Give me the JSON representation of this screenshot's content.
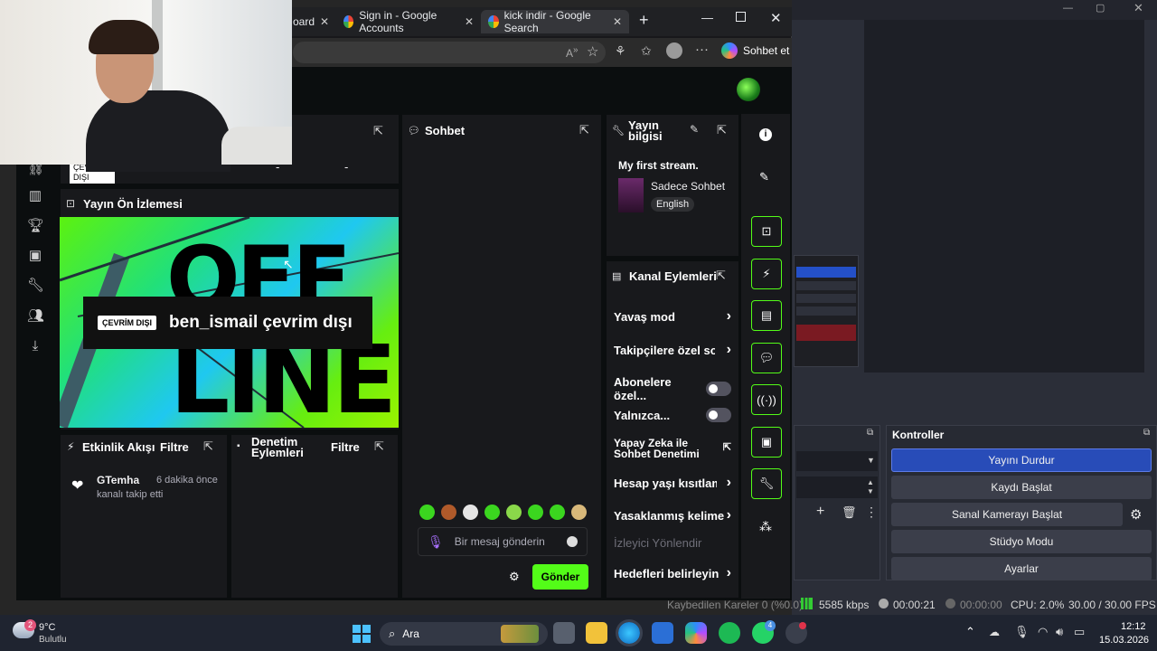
{
  "browser": {
    "tabs": [
      {
        "label": "oard",
        "icon": "kick-icon"
      },
      {
        "label": "Sign in - Google Accounts",
        "icon": "google-icon"
      },
      {
        "label": "kick indir - Google Search",
        "icon": "google-icon"
      }
    ],
    "copilot_label": "Sohbet et"
  },
  "stats": {
    "status_badge": "ÇEVRİM\nDIŞI",
    "values": [
      "-",
      "-",
      "-",
      "-"
    ]
  },
  "preview": {
    "title": "Yayın Ön İzlemesi",
    "offline_badge": "ÇEVRİM DIŞI",
    "offline_text": "ben_ismail çevrim dışı",
    "big_text_top": "OFF",
    "big_text_bottom": "LINE"
  },
  "activity": {
    "title": "Etkinlik Akışı",
    "filter": "Filtre",
    "items": [
      {
        "user": "GTemha",
        "time": "6 dakika önce",
        "desc": "kanalı takip etti"
      }
    ]
  },
  "moderation": {
    "title": "Denetim Eylemleri",
    "filter": "Filtre"
  },
  "chat": {
    "title": "Sohbet",
    "input_placeholder": "Bir mesaj gönderin",
    "send_label": "Gönder"
  },
  "stream_info": {
    "title": "Yayın bilgisi",
    "stream_title": "My first stream.",
    "category": "Sadece Sohbet",
    "language": "English"
  },
  "channel_actions": {
    "title": "Kanal Eylemleri",
    "items": [
      {
        "label": "Yavaş mod",
        "control": "chevron"
      },
      {
        "label": "Takipçilere özel soh",
        "control": "chevron"
      },
      {
        "label": "Abonelere özel...",
        "control": "toggle"
      },
      {
        "label": "Yalnızca...",
        "control": "toggle"
      },
      {
        "label": "Yapay Zeka ile Sohbet Denetimi",
        "control": "external"
      },
      {
        "label": "Hesap yaşı kısıtlam:",
        "control": "chevron"
      },
      {
        "label": "Yasaklanmış kelime",
        "control": "chevron"
      },
      {
        "label": "İzleyici Yönlendir",
        "control": "none"
      },
      {
        "label": "Hedefleri belirleyin",
        "control": "chevron"
      }
    ]
  },
  "obs": {
    "controls_title": "Kontroller",
    "buttons": [
      "Yayını Durdur",
      "Kaydı Başlat",
      "Sanal Kamerayı Başlat",
      "Stüdyo Modu",
      "Ayarlar"
    ],
    "statusbar": {
      "dropped": "Kaybedilen Kareler 0 (%0.0)",
      "bitrate": "5585 kbps",
      "stream_time": "00:00:21",
      "rec_time": "00:00:00",
      "cpu": "CPU: 2.0%",
      "fps": "30.00 / 30.00 FPS"
    }
  },
  "taskbar": {
    "weather_temp": "9°C",
    "weather_desc": "Bulutlu",
    "weather_badge": "2",
    "search_label": "Ara",
    "time": "12:12",
    "date": "15.03.2026",
    "whatsapp_badge": "4"
  },
  "colors": {
    "kick_green": "#53fc18",
    "obs_active": "#284cb8"
  }
}
